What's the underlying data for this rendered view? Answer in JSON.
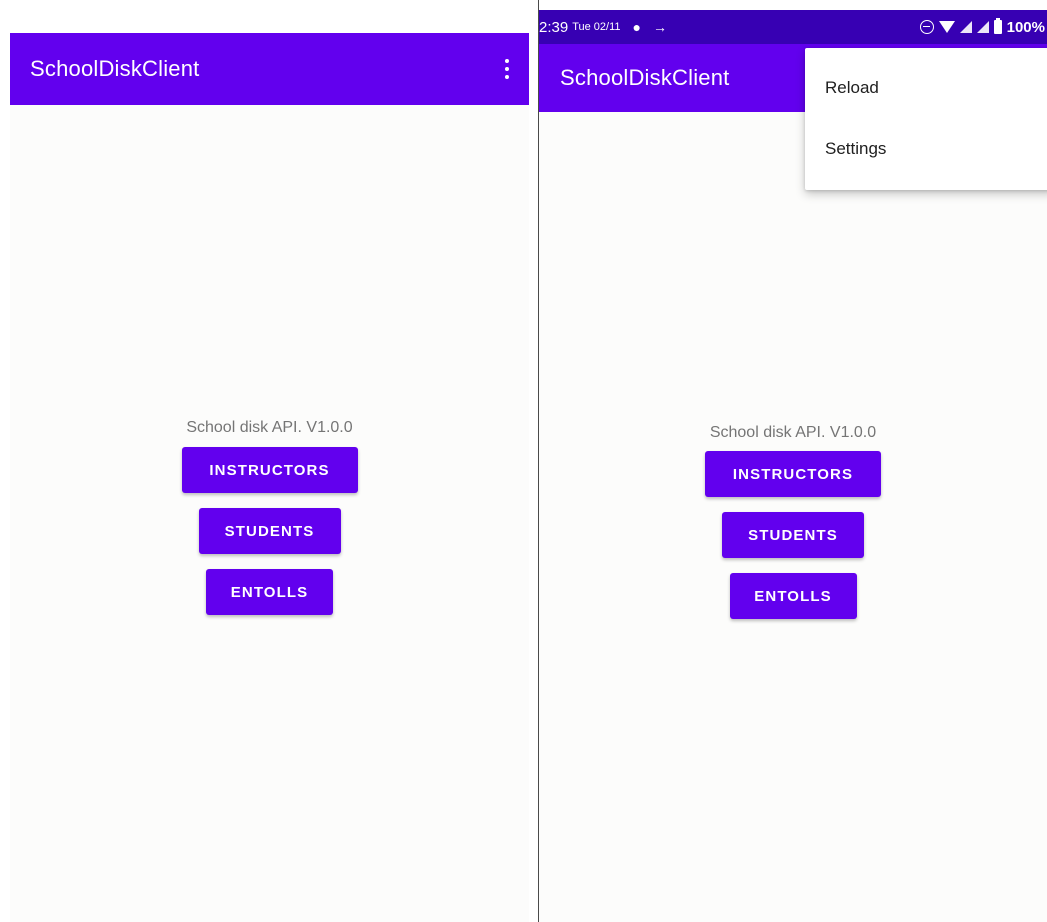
{
  "app": {
    "title": "SchoolDiskClient"
  },
  "main": {
    "api_label": "School disk API. V1.0.0",
    "buttons": {
      "instructors": "INSTRUCTORS",
      "students": "STUDENTS",
      "entolls": "ENTOLLS"
    }
  },
  "status_bar": {
    "time": "2:39",
    "date": "Tue 02/11",
    "battery": "100%"
  },
  "menu": {
    "items": [
      "Reload",
      "Settings"
    ]
  },
  "colors": {
    "primary": "#6200ee",
    "primary_dark": "#3700b3",
    "label_text": "#757575",
    "background": "#fcfcfb"
  },
  "icons": [
    "overflow-menu-icon",
    "ghost-notification-icon",
    "usb-debug-icon",
    "do-not-disturb-icon",
    "wifi-icon",
    "signal-icon",
    "battery-icon"
  ]
}
